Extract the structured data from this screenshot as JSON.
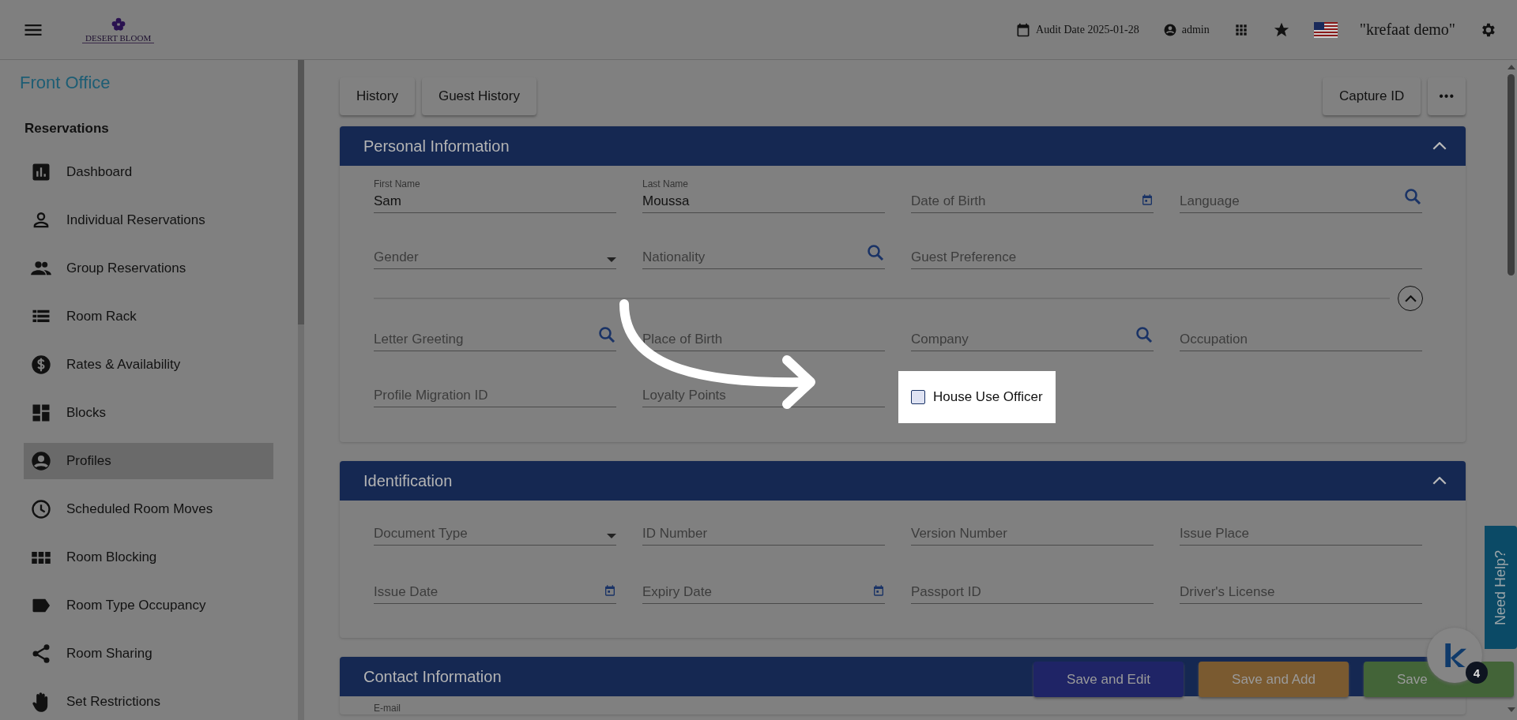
{
  "header": {
    "logo_text": "DESERT BLOOM",
    "audit_date": "Audit Date 2025-01-28",
    "user": "admin",
    "property": "\"krefaat demo\""
  },
  "sidebar": {
    "title": "Front Office",
    "group": "Reservations",
    "items": [
      {
        "label": "Dashboard",
        "selected": false
      },
      {
        "label": "Individual Reservations",
        "selected": false
      },
      {
        "label": "Group Reservations",
        "selected": false
      },
      {
        "label": "Room Rack",
        "selected": false
      },
      {
        "label": "Rates & Availability",
        "selected": false
      },
      {
        "label": "Blocks",
        "selected": false
      },
      {
        "label": "Profiles",
        "selected": true
      },
      {
        "label": "Scheduled Room Moves",
        "selected": false
      },
      {
        "label": "Room Blocking",
        "selected": false
      },
      {
        "label": "Room Type Occupancy",
        "selected": false
      },
      {
        "label": "Room Sharing",
        "selected": false
      },
      {
        "label": "Set Restrictions",
        "selected": false
      }
    ]
  },
  "toolbar": {
    "left_buttons": [
      "History",
      "Guest History"
    ],
    "right_buttons": [
      "Capture ID"
    ],
    "more_button": "•••"
  },
  "sections": [
    {
      "title": "Personal Information",
      "expanded": true,
      "more_expanded": true,
      "rows": [
        [
          {
            "label": "First Name",
            "value": "Sam",
            "kind": "text"
          },
          {
            "label": "Last Name",
            "value": "Moussa",
            "kind": "text"
          },
          {
            "label": "Date of Birth",
            "kind": "date"
          },
          {
            "label": "Language",
            "kind": "lookup"
          }
        ],
        [
          {
            "label": "Gender",
            "kind": "select"
          },
          {
            "label": "Nationality",
            "kind": "lookup"
          },
          {
            "label": "Guest Preference",
            "kind": "text"
          }
        ]
      ],
      "more_rows": [
        [
          {
            "label": "Letter Greeting",
            "kind": "lookup"
          },
          {
            "label": "Place of Birth",
            "kind": "text"
          },
          {
            "label": "Company",
            "kind": "lookup"
          },
          {
            "label": "Occupation",
            "kind": "text"
          }
        ],
        [
          {
            "label": "Profile Migration ID",
            "kind": "text"
          },
          {
            "label": "Loyalty Points",
            "kind": "text"
          },
          {
            "label": "House Use Officer",
            "kind": "checkbox",
            "checked": false,
            "highlighted": true
          }
        ]
      ]
    },
    {
      "title": "Identification",
      "expanded": true,
      "rows": [
        [
          {
            "label": "Document Type",
            "kind": "select"
          },
          {
            "label": "ID Number",
            "kind": "text"
          },
          {
            "label": "Version Number",
            "kind": "text"
          },
          {
            "label": "Issue Place",
            "kind": "text"
          }
        ],
        [
          {
            "label": "Issue Date",
            "kind": "date"
          },
          {
            "label": "Expiry Date",
            "kind": "date"
          },
          {
            "label": "Passport ID",
            "kind": "text"
          },
          {
            "label": "Driver's License",
            "kind": "text"
          }
        ]
      ]
    },
    {
      "title": "Contact Information",
      "rows": [
        [
          {
            "label": "E-mail",
            "kind": "caption"
          }
        ]
      ]
    }
  ],
  "action_buttons": [
    {
      "label": "Save and Edit",
      "color": "#1f2466"
    },
    {
      "label": "Save and Add",
      "color": "#7a5a30"
    },
    {
      "label": "Save",
      "color": "#436438"
    }
  ],
  "help_tab": "Need Help?",
  "assistant_badge": "4"
}
